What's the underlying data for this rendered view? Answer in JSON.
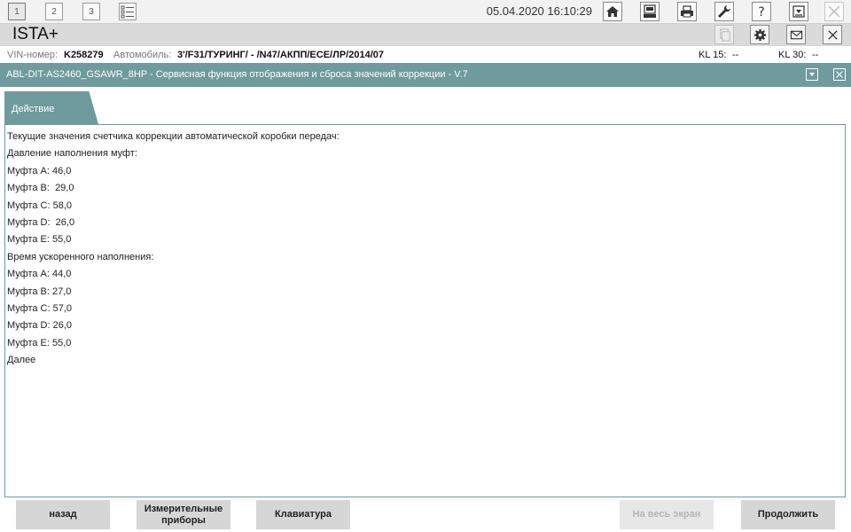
{
  "toolbar": {
    "windows": [
      "1",
      "2",
      "3"
    ],
    "datetime": "05.04.2020 16:10:29"
  },
  "app": {
    "title": "ISTA+"
  },
  "vehicle": {
    "vin_label": "VIN-номер:",
    "vin_value": "K258279",
    "car_label": "Автомобиль:",
    "car_value": "3'/F31/ТУРИНГ/ - /N47/АКПП/ЕСЕ/ЛР/2014/07",
    "kl15_label": "KL 15:",
    "kl15_value": "--",
    "kl30_label": "KL 30:",
    "kl30_value": "--"
  },
  "function": {
    "title": "ABL-DIT-AS2460_GSAWR_8HP - Сервисная функция отображения и сброса значений коррекции - V.7"
  },
  "tab": {
    "label": "Действие"
  },
  "content": {
    "lines": [
      "Текущие значения счетчика коррекции автоматической коробки передач:",
      "Давление наполнения муфт:",
      "Муфта A: 46,0",
      "Муфта B:  29,0",
      "Муфта C: 58,0",
      "Муфта D:  26,0",
      "Муфта E: 55,0",
      "Время ускоренного наполнения:",
      "Муфта A: 44,0",
      "Муфта B: 27,0",
      "Муфта C: 57,0",
      "Муфта D: 26,0",
      "Муфта E: 55,0",
      "Далее"
    ]
  },
  "buttons": {
    "back": "назад",
    "measuring_line1": "Измерительные",
    "measuring_line2": "приборы",
    "keyboard": "Клавиатура",
    "fullscreen": "На весь экран",
    "continue": "Продолжить"
  }
}
